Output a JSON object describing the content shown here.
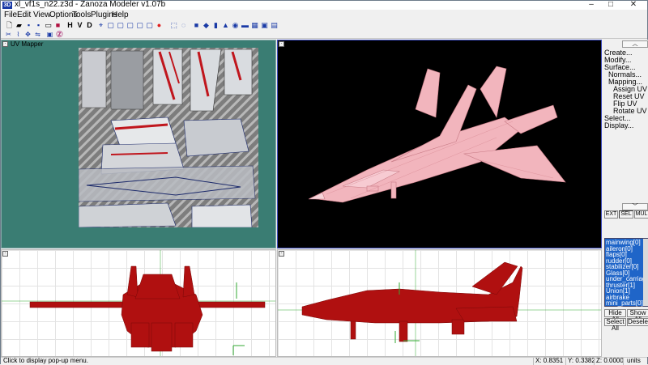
{
  "window": {
    "title": "xl_vf1s_n22.z3d - Zanoza Modeler v1.07b",
    "app_icon": "3D"
  },
  "menu": [
    "File",
    "Edit",
    "View",
    "Options",
    "Tools",
    "Plugins",
    "Help"
  ],
  "toolbar": {
    "row1": [
      "new-icon",
      "open-icon",
      "save-icon",
      "save-as-icon",
      "print-icon",
      "close-doc-icon",
      "H",
      "V",
      "D",
      "select-icon",
      "box-icon",
      "box2-icon",
      "box3-icon",
      "box4-icon",
      "box5-icon",
      "view-icon",
      "sphere-icon",
      "dot-icon",
      "select-rect-icon",
      "select-circle-icon",
      "cube-icon",
      "cube2-icon",
      "cylinder-icon",
      "cone-icon",
      "torus-icon",
      "plane-icon",
      "grid-icon",
      "face-icon",
      "render-icon"
    ],
    "row2": [
      "cut-icon",
      "polyline-icon",
      "move-icon",
      "mirror-icon",
      "uv-icon",
      "z-icon"
    ]
  },
  "viewports": {
    "uv_mapper": {
      "label": "UV Mapper"
    }
  },
  "panel": {
    "menu": [
      "Create...",
      "Modify...",
      "Surface..."
    ],
    "submenu": [
      "Normals...",
      "Mapping..."
    ],
    "mapping_items": [
      "Assign UV",
      "Reset UV",
      "Flip UV",
      "Rotate UV"
    ],
    "menu2": [
      "Select...",
      "Display..."
    ],
    "modes": [
      "EXT",
      "SEL",
      "MUL"
    ],
    "groups": [
      "mainwing[0]",
      "aileron[0]",
      "flaps[0]",
      "rudder[0]",
      "stabilizer[0]",
      "Glass[0]",
      "under_carriage",
      "thruster[1]",
      "Union[1]",
      "airbrake",
      "mini_parts[0]"
    ],
    "buttons": {
      "hide_all": "Hide All",
      "show_all": "Show All",
      "select_all": "Select All",
      "deselect": "Deselect"
    }
  },
  "status": {
    "message": "Click to display pop-up menu.",
    "x": "X: 0.8351",
    "y": "Y: 0.3382",
    "z": "Z: 0.0000",
    "units": "units"
  },
  "colors": {
    "model_red": "#b01010",
    "model_pink": "#f2b5bd",
    "uv_bg": "#3a7d73",
    "select_blue": "#1f65c8"
  }
}
